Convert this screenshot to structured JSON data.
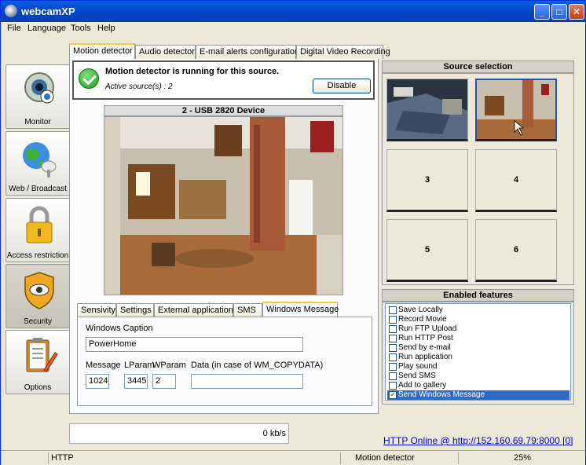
{
  "window": {
    "title": "webcamXP"
  },
  "menu": [
    "File",
    "Language",
    "Tools",
    "Help"
  ],
  "nav": [
    {
      "label": "Monitor",
      "icon": "webcam-icon"
    },
    {
      "label": "Web / Broadcast",
      "icon": "globe-satellite-icon"
    },
    {
      "label": "Access restriction",
      "icon": "padlock-icon"
    },
    {
      "label": "Security",
      "icon": "shield-eye-icon"
    },
    {
      "label": "Options",
      "icon": "clipboard-pencil-icon"
    }
  ],
  "top_tabs": [
    "Motion detector",
    "Audio detector",
    "E-mail alerts configuration",
    "Digital Video Recording"
  ],
  "status": {
    "message": "Motion detector is running for this source.",
    "active_sources": "Active source(s) : 2",
    "disable_label": "Disable"
  },
  "camera": {
    "title": "2 - USB 2820 Device"
  },
  "sub_tabs": [
    "Sensivity",
    "Settings",
    "External application",
    "SMS",
    "Windows Message"
  ],
  "windows_message": {
    "caption_label": "Windows Caption",
    "caption_value": "PowerHome",
    "message_label": "Message",
    "lparam_label": "LParam",
    "wparam_label": "WParam",
    "data_label": "Data (in case of WM_COPYDATA)",
    "message_value": "1024",
    "lparam_value": "3445",
    "wparam_value": "2",
    "data_value": ""
  },
  "source_selection": {
    "title": "Source selection",
    "slots": [
      "",
      "",
      "3",
      "4",
      "5",
      "6"
    ]
  },
  "enabled_features": {
    "title": "Enabled features",
    "items": [
      {
        "label": "Save Locally",
        "checked": false
      },
      {
        "label": "Record Movie",
        "checked": false
      },
      {
        "label": "Run FTP Upload",
        "checked": false
      },
      {
        "label": "Run HTTP Post",
        "checked": false
      },
      {
        "label": "Send by e-mail",
        "checked": false
      },
      {
        "label": "Run application",
        "checked": false
      },
      {
        "label": "Play sound",
        "checked": false
      },
      {
        "label": "Send SMS",
        "checked": false
      },
      {
        "label": "Add to gallery",
        "checked": false
      },
      {
        "label": "Send Windows Message",
        "checked": true
      }
    ]
  },
  "bandwidth": "0 kb/s",
  "http_link": "HTTP Online @ http://152.160.69.79:8000 [0]",
  "statusbar": {
    "protocol": "HTTP",
    "mode": "Motion detector",
    "cpu": "25%"
  },
  "colors": {
    "titlebar": "#0653d8",
    "selection": "#316ac5",
    "active_tab_accent": "#ffc83c"
  }
}
